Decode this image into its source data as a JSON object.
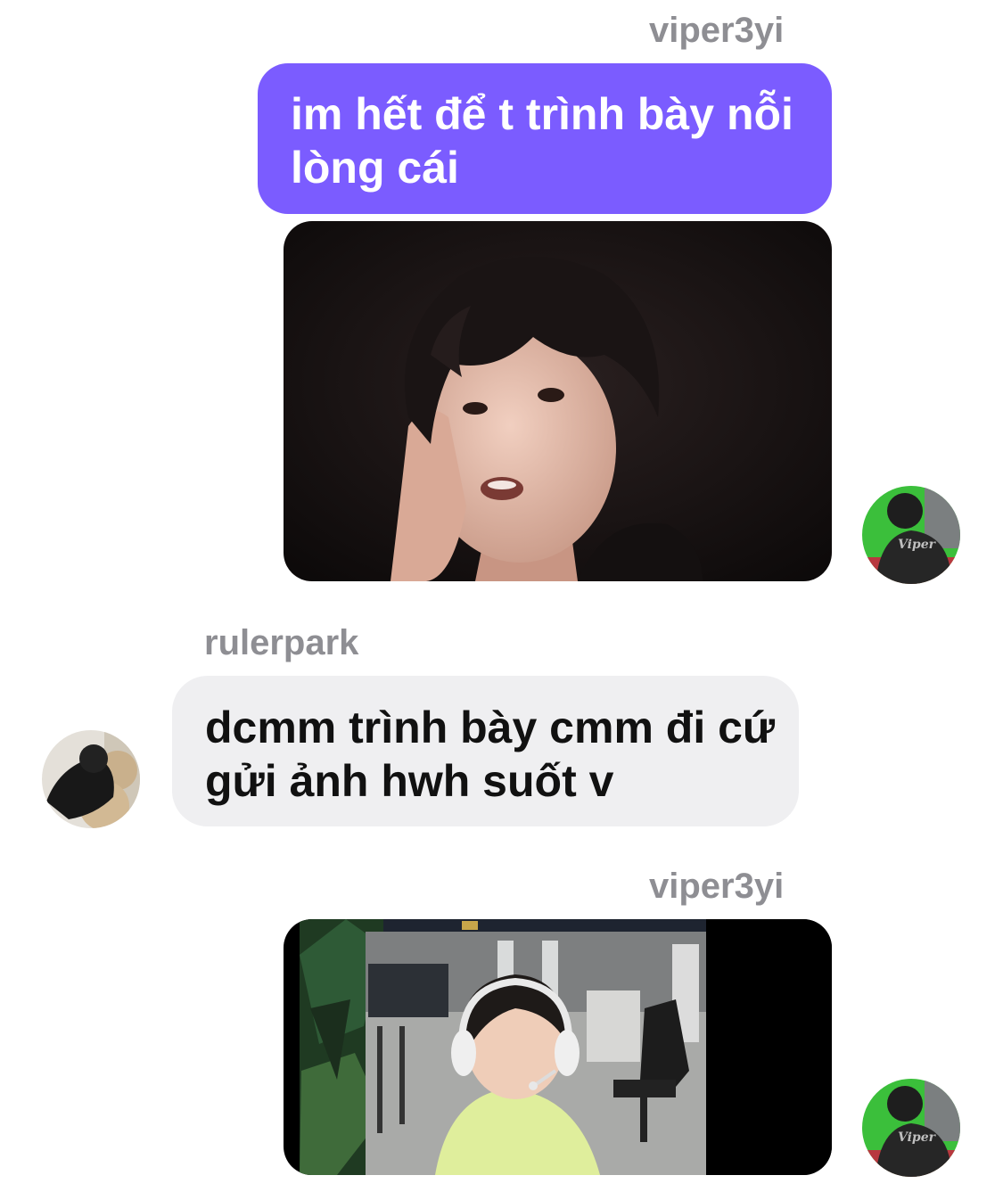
{
  "messages": [
    {
      "sender": "viper3yi",
      "direction": "outgoing",
      "type": "text",
      "lines": [
        "im hết để t trình bày nỗi",
        "lòng cái"
      ]
    },
    {
      "sender": "viper3yi",
      "direction": "outgoing",
      "type": "image",
      "image_icon": "photo-icon"
    },
    {
      "sender": "rulerpark",
      "direction": "incoming",
      "type": "text",
      "lines": [
        "dcmm trình bày cmm đi cứ",
        "gửi ảnh hwh suốt v"
      ]
    },
    {
      "sender": "viper3yi",
      "direction": "outgoing",
      "type": "image",
      "image_icon": "video-screenshot-icon"
    }
  ],
  "avatars": {
    "viper3yi": {
      "shirt_text": "Viper"
    }
  },
  "colors": {
    "outgoing_bubble": "#7b5cff",
    "incoming_bubble": "#efeff1",
    "sender_name": "#8e8e93"
  }
}
